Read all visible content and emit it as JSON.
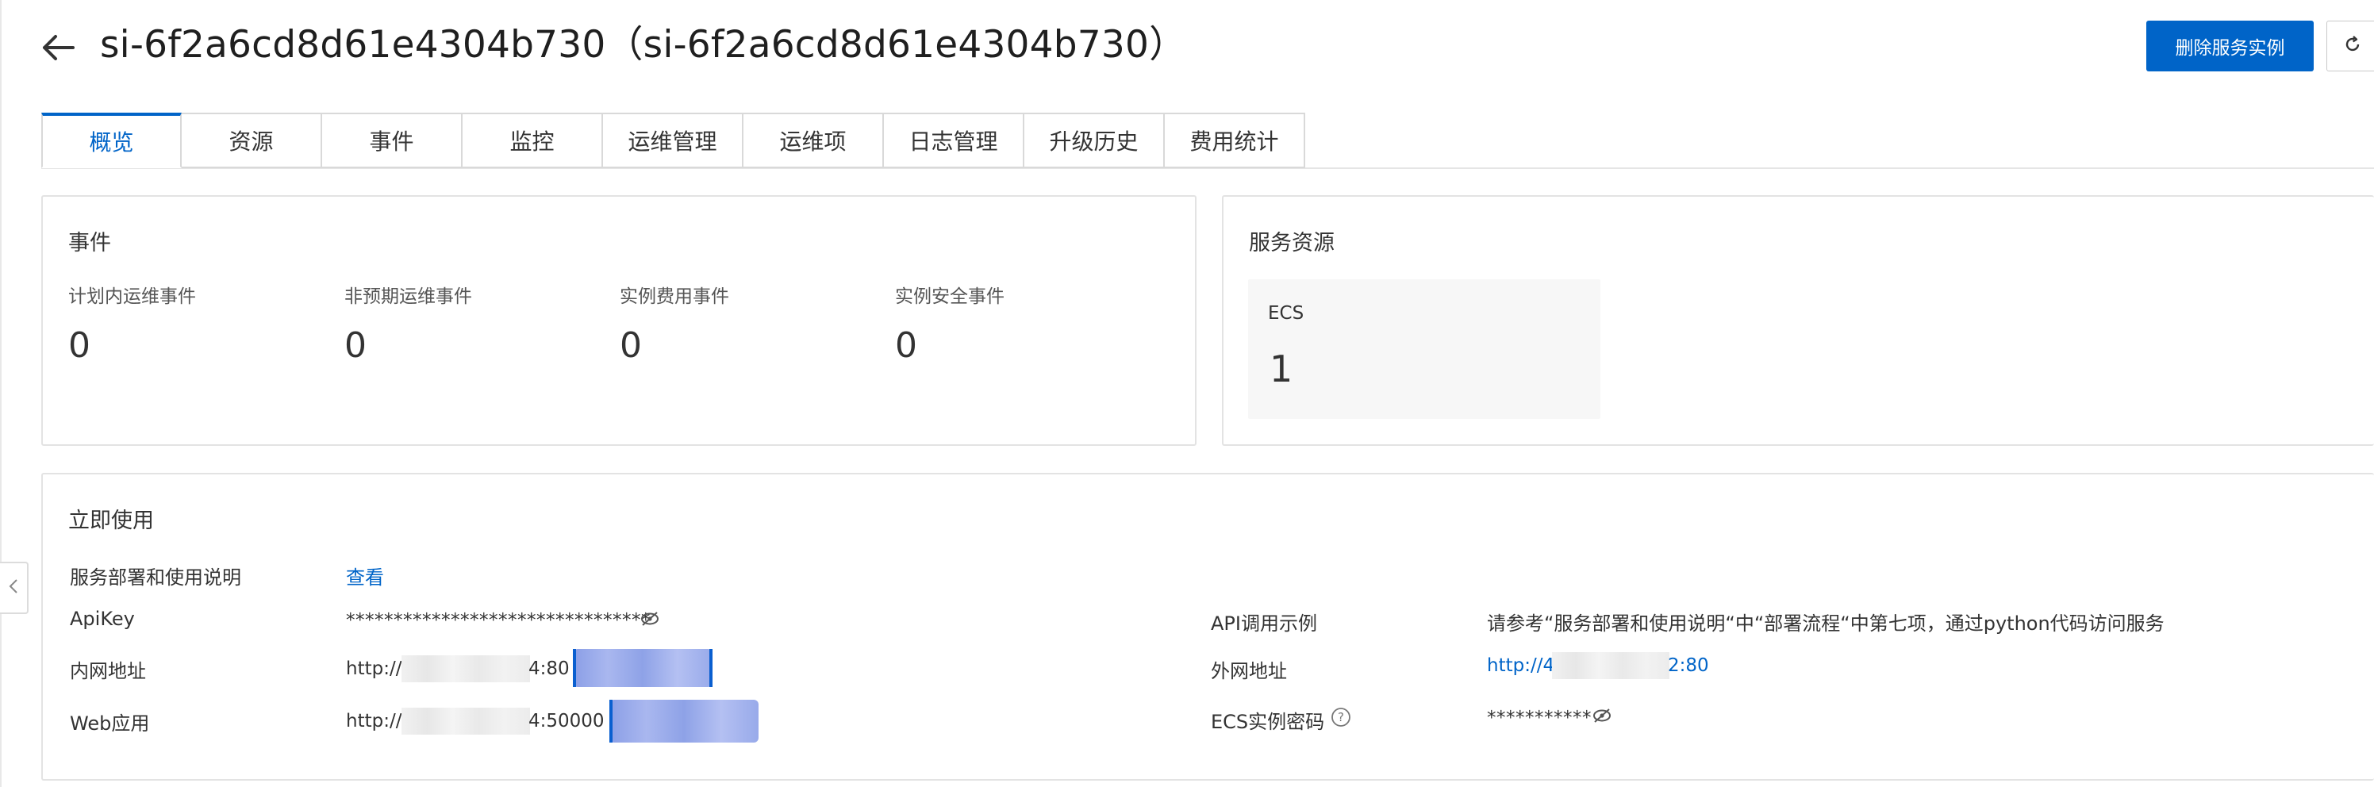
{
  "header": {
    "title": "si-6f2a6cd8d61e4304b730（si-6f2a6cd8d61e4304b730）",
    "delete_button": "删除服务实例",
    "back_icon": "arrow-left-icon",
    "refresh_icon": "refresh-icon"
  },
  "tabs": [
    {
      "label": "概览",
      "active": true
    },
    {
      "label": "资源"
    },
    {
      "label": "事件"
    },
    {
      "label": "监控"
    },
    {
      "label": "运维管理"
    },
    {
      "label": "运维项"
    },
    {
      "label": "日志管理"
    },
    {
      "label": "升级历史"
    },
    {
      "label": "费用统计"
    }
  ],
  "events": {
    "title": "事件",
    "stats": [
      {
        "label": "计划内运维事件",
        "value": "0"
      },
      {
        "label": "非预期运维事件",
        "value": "0"
      },
      {
        "label": "实例费用事件",
        "value": "0"
      },
      {
        "label": "实例安全事件",
        "value": "0"
      }
    ]
  },
  "resources": {
    "title": "服务资源",
    "ecs_label": "ECS",
    "ecs_count": "1"
  },
  "usage": {
    "title": "立即使用",
    "guide_label": "服务部署和使用说明",
    "guide_link": "查看",
    "apikey_label": "ApiKey",
    "apikey_value": "********************************",
    "intranet_label": "内网地址",
    "intranet_prefix": "http://",
    "intranet_suffix": "4:80",
    "webapp_label": "Web应用",
    "webapp_prefix": "http://",
    "webapp_suffix": "4:50000",
    "api_example_label": "API调用示例",
    "api_example_value": "请参考“服务部署和使用说明“中“部署流程“中第七项，通过python代码访问服务",
    "public_label": "外网地址",
    "public_prefix": "http://4",
    "public_suffix": "2:80",
    "ecs_password_label": "ECS实例密码",
    "ecs_password_value": "***********"
  },
  "colors": {
    "primary": "#0064c8",
    "border": "#e3e3e3"
  }
}
